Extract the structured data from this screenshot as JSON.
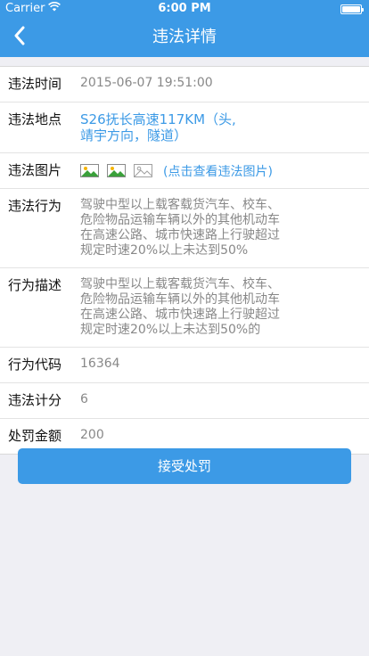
{
  "status_bar": {
    "carrier": "Carrier",
    "time": "6:00 PM"
  },
  "nav": {
    "title": "违法详情",
    "back_icon": "chevron-left-icon"
  },
  "details": {
    "time": {
      "label": "违法时间",
      "value": "2015-06-07 19:51:00"
    },
    "location": {
      "label": "违法地点",
      "value": "S26抚长高速117KM（头,靖宇方向，隧道）"
    },
    "images": {
      "label": "违法图片",
      "link_text": "(点击查看违法图片)",
      "icons": [
        "image-icon",
        "image-icon",
        "image-placeholder-icon"
      ]
    },
    "behavior": {
      "label": "违法行为",
      "value": "驾驶中型以上载客载货汽车、校车、危险物品运输车辆以外的其他机动车在高速公路、城市快速路上行驶超过规定时速20%以上未达到50%"
    },
    "description": {
      "label": "行为描述",
      "value": "驾驶中型以上载客载货汽车、校车、危险物品运输车辆以外的其他机动车在高速公路、城市快速路上行驶超过规定时速20%以上未达到50%的"
    },
    "code": {
      "label": "行为代码",
      "value": "16364"
    },
    "points": {
      "label": "违法计分",
      "value": "6"
    },
    "fine": {
      "label": "处罚金额",
      "value": "200"
    }
  },
  "actions": {
    "accept_label": "接受处罚"
  },
  "colors": {
    "accent": "#3c9ae6",
    "label_text": "#111111",
    "value_text": "#888888",
    "background": "#efeff4"
  }
}
